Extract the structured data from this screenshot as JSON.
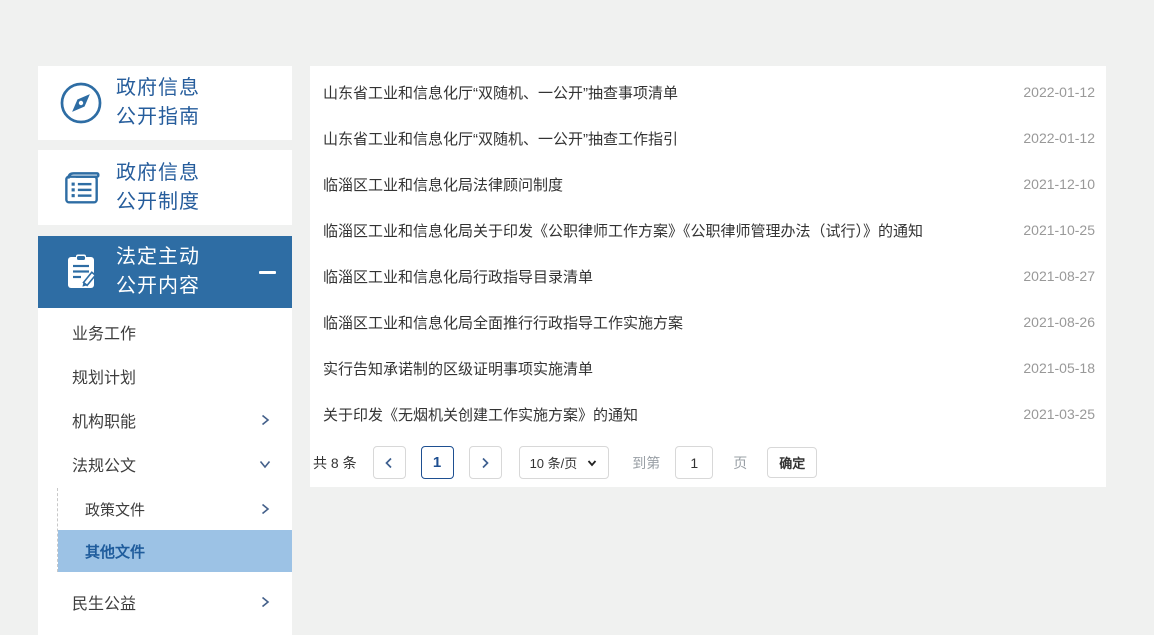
{
  "sidebar": {
    "cards": [
      {
        "icon": "compass-icon",
        "line1": "政府信息",
        "line2": "公开指南"
      },
      {
        "icon": "book-icon",
        "line1": "政府信息",
        "line2": "公开制度"
      }
    ],
    "nav_header": {
      "icon": "clipboard-pencil-icon",
      "line1": "法定主动",
      "line2": "公开内容"
    },
    "menu": [
      {
        "label": "业务工作",
        "chevron": "none"
      },
      {
        "label": "规划计划",
        "chevron": "none"
      },
      {
        "label": "机构职能",
        "chevron": "right"
      },
      {
        "label": "法规公文",
        "chevron": "down",
        "children": [
          {
            "label": "政策文件",
            "chevron": "right"
          },
          {
            "label": "其他文件",
            "chevron": "none",
            "active": true
          }
        ]
      },
      {
        "label": "民生公益",
        "chevron": "right"
      }
    ]
  },
  "list": {
    "items": [
      {
        "title": "山东省工业和信息化厅“双随机、一公开”抽查事项清单",
        "date": "2022-01-12"
      },
      {
        "title": "山东省工业和信息化厅“双随机、一公开”抽查工作指引",
        "date": "2022-01-12"
      },
      {
        "title": "临淄区工业和信息化局法律顾问制度",
        "date": "2021-12-10"
      },
      {
        "title": "临淄区工业和信息化局关于印发《公职律师工作方案》《公职律师管理办法（试行）》的通知",
        "date": "2021-10-25"
      },
      {
        "title": "临淄区工业和信息化局行政指导目录清单",
        "date": "2021-08-27"
      },
      {
        "title": "临淄区工业和信息化局全面推行行政指导工作实施方案",
        "date": "2021-08-26"
      },
      {
        "title": "实行告知承诺制的区级证明事项实施清单",
        "date": "2021-05-18"
      },
      {
        "title": "关于印发《无烟机关创建工作实施方案》的通知",
        "date": "2021-03-25"
      }
    ]
  },
  "pagination": {
    "total_label": "共 8 条",
    "current_page": "1",
    "page_size_label": "10 条/页",
    "goto_prefix": "到第",
    "goto_value": "1",
    "goto_suffix": "页",
    "confirm_label": "确定"
  },
  "colors": {
    "accent_blue": "#2e6da4",
    "sidebar_text_blue": "#265d9c",
    "active_item_bg": "#9cc2e5",
    "active_item_text": "#1f5c9c",
    "date_text": "#999999",
    "current_page_border": "#1e4f91",
    "page_background": "#f0f1f0"
  }
}
